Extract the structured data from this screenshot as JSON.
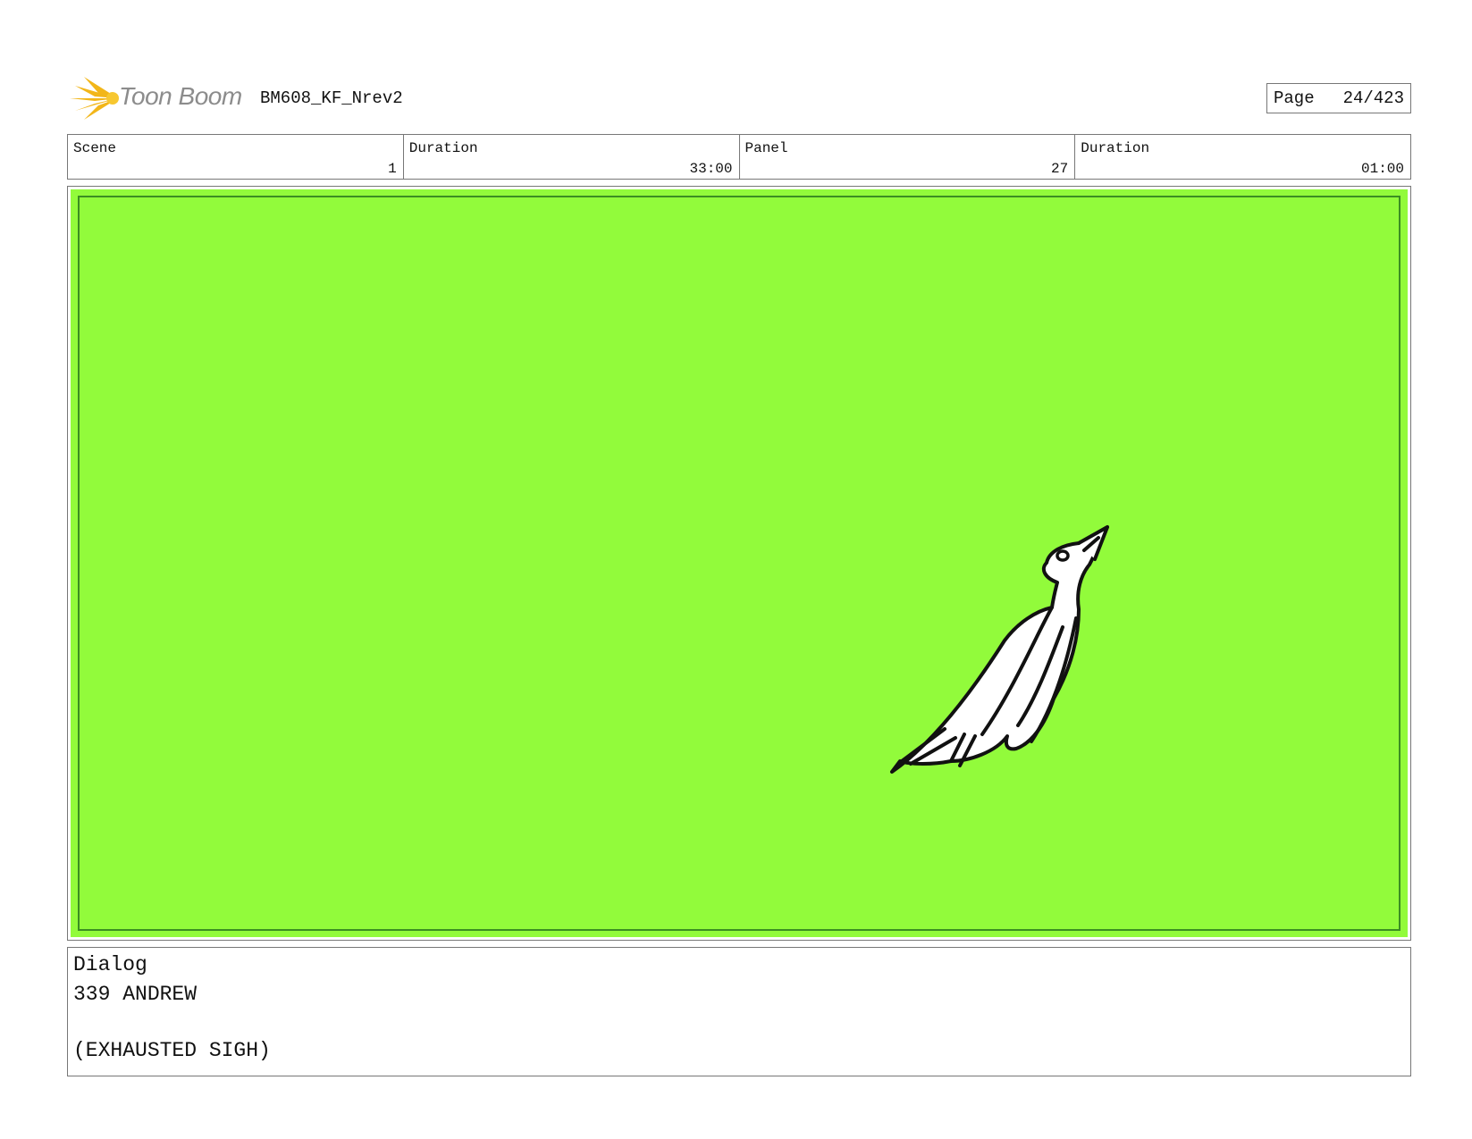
{
  "header": {
    "logo_text": "Toon Boom",
    "document_title": "BM608_KF_Nrev2",
    "page_label": "Page",
    "page_number": "24/423"
  },
  "info": {
    "scene_label": "Scene",
    "scene_value": "1",
    "scene_duration_label": "Duration",
    "scene_duration_value": "33:00",
    "panel_label": "Panel",
    "panel_value": "27",
    "panel_duration_label": "Duration",
    "panel_duration_value": "01:00"
  },
  "panel": {
    "background_color": "#92fb3b",
    "subject": "bird-sketch"
  },
  "dialog": {
    "label": "Dialog",
    "speaker": "339 ANDREW",
    "line": "(EXHAUSTED SIGH)"
  }
}
